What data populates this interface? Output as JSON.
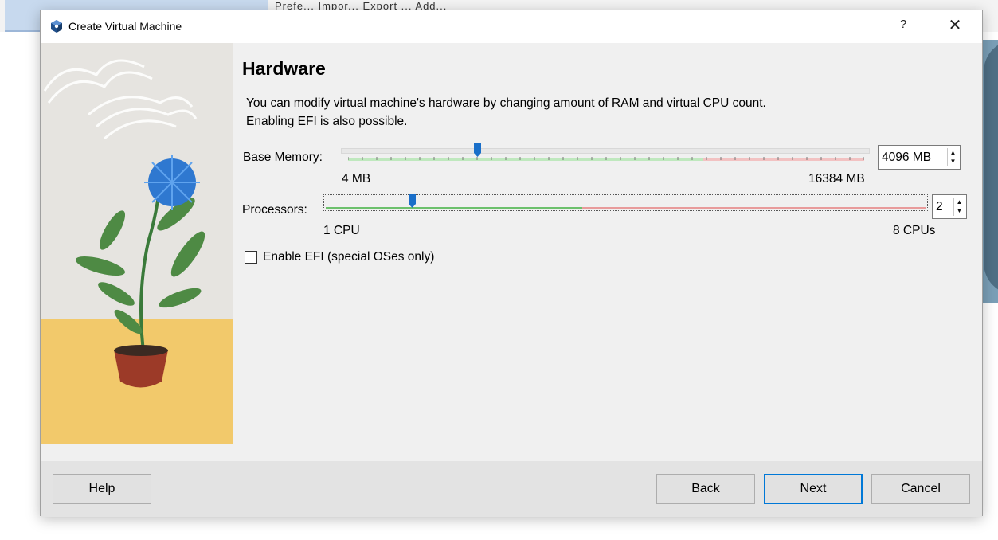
{
  "background": {
    "tabs_text": "Prefe...  Impor...  Export  ...  Add..."
  },
  "dialog": {
    "title": "Create Virtual Machine",
    "help_glyph": "?",
    "close_glyph": "✕",
    "icon": "virtualbox-logo-icon"
  },
  "page": {
    "heading": "Hardware",
    "description_line1": "You can modify virtual machine's hardware by changing amount of RAM and virtual CPU count.",
    "description_line2": "Enabling EFI is also possible."
  },
  "memory": {
    "label": "Base Memory:",
    "min_label": "4 MB",
    "max_label": "16384 MB",
    "value": 4096,
    "value_text": "4096 MB",
    "min": 4,
    "max": 16384,
    "recommended_fraction": 0.69
  },
  "processors": {
    "label": "Processors:",
    "min_label": "1 CPU",
    "max_label": "8 CPUs",
    "value": 2,
    "value_text": "2",
    "min": 1,
    "max": 8,
    "recommended_fraction": 0.43
  },
  "efi": {
    "label": "Enable EFI (special OSes only)",
    "checked": false
  },
  "buttons": {
    "help": "Help",
    "back": "Back",
    "next": "Next",
    "cancel": "Cancel"
  },
  "colors": {
    "accent": "#0078d7",
    "slider_thumb": "#1a6fc9",
    "recommended_range": "#bfe8be",
    "over_range": "#f2c2c2",
    "floor": "#f2c96b"
  }
}
